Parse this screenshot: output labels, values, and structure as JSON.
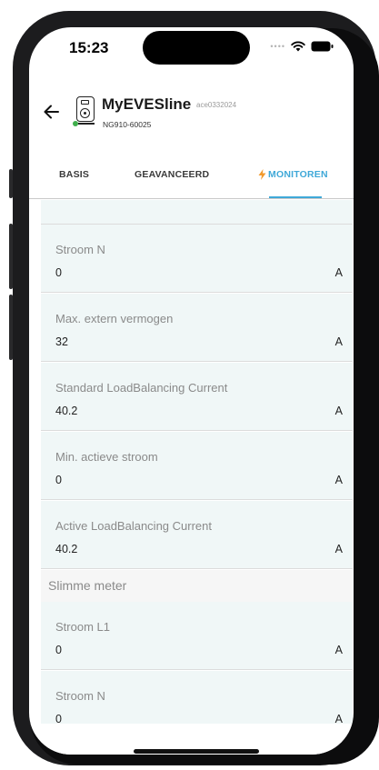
{
  "status_bar": {
    "time": "15:23",
    "signal_icon": "signal-dots-icon",
    "wifi_icon": "wifi-icon",
    "battery_icon": "battery-icon"
  },
  "header": {
    "back_icon": "arrow-left-icon",
    "device_icon": "charger-icon",
    "device_name": "MyEVESline",
    "device_id": "ace0332024",
    "device_serial": "NG910-60025",
    "online_color": "#3fae4c"
  },
  "tabs": {
    "items": [
      {
        "label": "BASIS"
      },
      {
        "label": "GEAVANCEERD"
      },
      {
        "label": "MONITOREN"
      }
    ],
    "active_color": "#3fa8d8",
    "active_icon": "lightning-icon"
  },
  "list": {
    "rows": [
      {
        "label": "Stroom N",
        "value": "0",
        "unit": "A"
      },
      {
        "label": "Max. extern vermogen",
        "value": "32",
        "unit": "A"
      },
      {
        "label": "Standard LoadBalancing Current",
        "value": "40.2",
        "unit": "A"
      },
      {
        "label": "Min. actieve stroom",
        "value": "0",
        "unit": "A"
      },
      {
        "label": "Active LoadBalancing Current",
        "value": "40.2",
        "unit": "A"
      }
    ],
    "section_title": "Slimme meter",
    "meter_rows": [
      {
        "label": "Stroom L1",
        "value": "0",
        "unit": "A"
      },
      {
        "label": "Stroom N",
        "value": "0",
        "unit": "A"
      }
    ]
  }
}
